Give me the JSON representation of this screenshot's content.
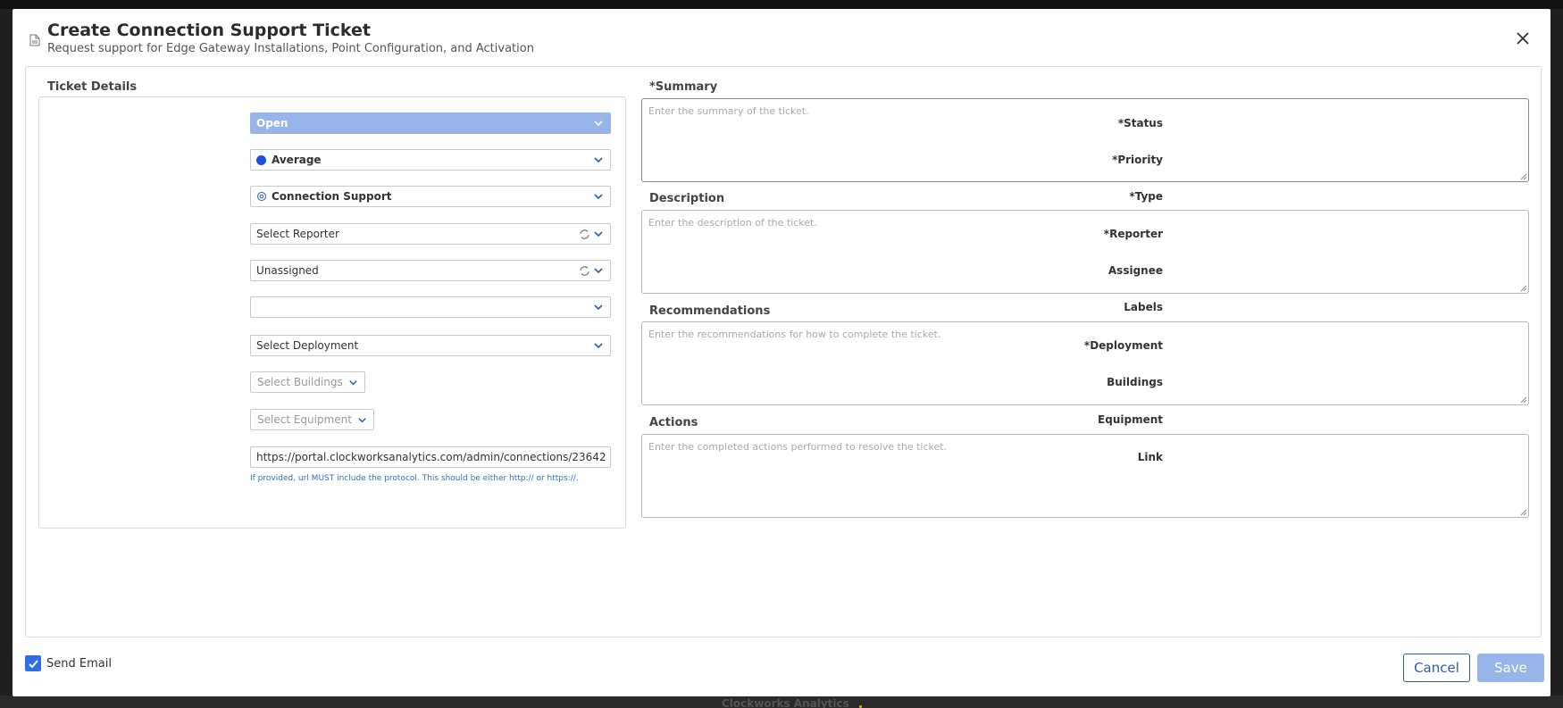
{
  "modal": {
    "title": "Create Connection Support Ticket",
    "subtitle": "Request support for Edge Gateway Installations, Point Configuration, and Activation"
  },
  "details": {
    "section_title": "Ticket Details",
    "status": {
      "label": "*Status",
      "value": "Open"
    },
    "priority": {
      "label": "*Priority",
      "value": "Average",
      "dot_color": "#1f4ed8"
    },
    "type": {
      "label": "*Type",
      "value": "Connection Support"
    },
    "reporter": {
      "label": "*Reporter",
      "placeholder": "Select Reporter"
    },
    "assignee": {
      "label": "Assignee",
      "value": "Unassigned"
    },
    "labels": {
      "label": "Labels",
      "value": ""
    },
    "deployment": {
      "label": "*Deployment",
      "placeholder": "Select Deployment"
    },
    "buildings": {
      "label": "Buildings",
      "placeholder": "Select Buildings"
    },
    "equipment": {
      "label": "Equipment",
      "placeholder": "Select Equipment"
    },
    "link": {
      "label": "Link",
      "value": "https://portal.clockworksanalytics.com/admin/connections/23642",
      "hint": "If provided, url MUST include the protocol. This should be either http:// or https://."
    }
  },
  "fields": {
    "summary": {
      "label": "*Summary",
      "placeholder": "Enter the summary of the ticket."
    },
    "description": {
      "label": "Description",
      "placeholder": "Enter the description of the ticket."
    },
    "recommendations": {
      "label": "Recommendations",
      "placeholder": "Enter the recommendations for how to complete the ticket."
    },
    "actions": {
      "label": "Actions",
      "placeholder": "Enter the completed actions performed to resolve the ticket."
    }
  },
  "footer": {
    "send_email_label": "Send Email",
    "send_email_checked": true,
    "cancel_label": "Cancel",
    "save_label": "Save"
  },
  "background": {
    "brand": "Clockworks Analytics"
  },
  "colors": {
    "accent": "#2a5bb5",
    "status_fill": "#98b5ea",
    "checkbox": "#2f6fe4"
  }
}
